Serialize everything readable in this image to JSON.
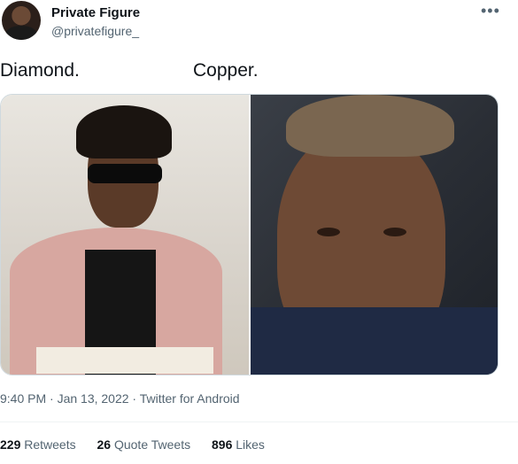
{
  "user": {
    "name": "Private Figure",
    "handle": "@privatefigure_"
  },
  "tweet": {
    "text_left": "Diamond.",
    "text_right": "Copper."
  },
  "meta": {
    "timestamp": "9:40 PM · Jan 13, 2022 · Twitter for Android"
  },
  "stats": {
    "retweets_count": "229",
    "retweets_label": "Retweets",
    "quotes_count": "26",
    "quotes_label": "Quote Tweets",
    "likes_count": "896",
    "likes_label": "Likes"
  },
  "icons": {
    "more": "more-icon"
  },
  "colors": {
    "text_primary": "#0f1419",
    "text_secondary": "#536471",
    "border": "#cfd9de"
  }
}
